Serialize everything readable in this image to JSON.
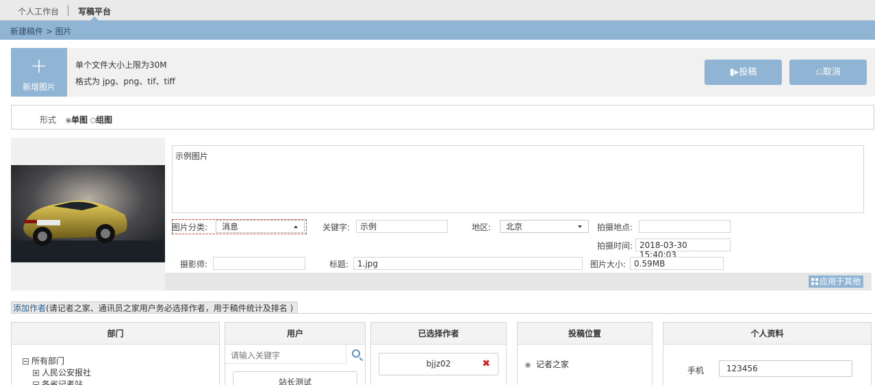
{
  "topnav": {
    "items": [
      "个人工作台",
      "写稿平台"
    ]
  },
  "breadcrumb": "新建稿件 > 图片",
  "upload": {
    "add_label": "新增图片",
    "hint_size": "单个文件大小上限为30M",
    "hint_format": "格式为 jpg、png、tif、tiff",
    "submit_label": "投稿",
    "cancel_label": "取消"
  },
  "form_type": {
    "label": "形式",
    "options": [
      {
        "label": "单图",
        "selected": true
      },
      {
        "label": "组图",
        "selected": false
      }
    ]
  },
  "image": {
    "description": "示例图片",
    "category_label": "图片分类:",
    "category_value": "消息",
    "keyword_label": "关键字:",
    "keyword_value": "示例",
    "region_label": "地区:",
    "region_value": "北京",
    "location_label": "拍摄地点:",
    "location_value": "",
    "time_label": "拍摄时间:",
    "time_value": "2018-03-30 15:40:03",
    "photographer_label": "摄影师:",
    "photographer_value": "",
    "title_label": "标题:",
    "title_value": "1.jpg",
    "size_label": "图片大小:",
    "size_value": "0.59MB",
    "apply_label": "应用于其他"
  },
  "authors": {
    "tab_link": "添加作者",
    "tab_note": "(请记者之家、通讯员之家用户务必选择作者，用于稿件统计及排名 )",
    "dept_header": "部门",
    "dept_tree": [
      "所有部门",
      "人民公安报社",
      "各省记者站"
    ],
    "user_header": "用户",
    "user_search_placeholder": "请输入关键字",
    "user_first": "站长测试",
    "selected_header": "已选择作者",
    "selected_author": "bjjz02",
    "position_header": "投稿位置",
    "position_option": "记者之家",
    "profile_header": "个人资料",
    "profile_phone_label": "手机",
    "profile_phone_value": "123456"
  },
  "colors": {
    "accent": "#8fb4d4",
    "link": "#2a5e8f",
    "remove": "#d42020"
  }
}
